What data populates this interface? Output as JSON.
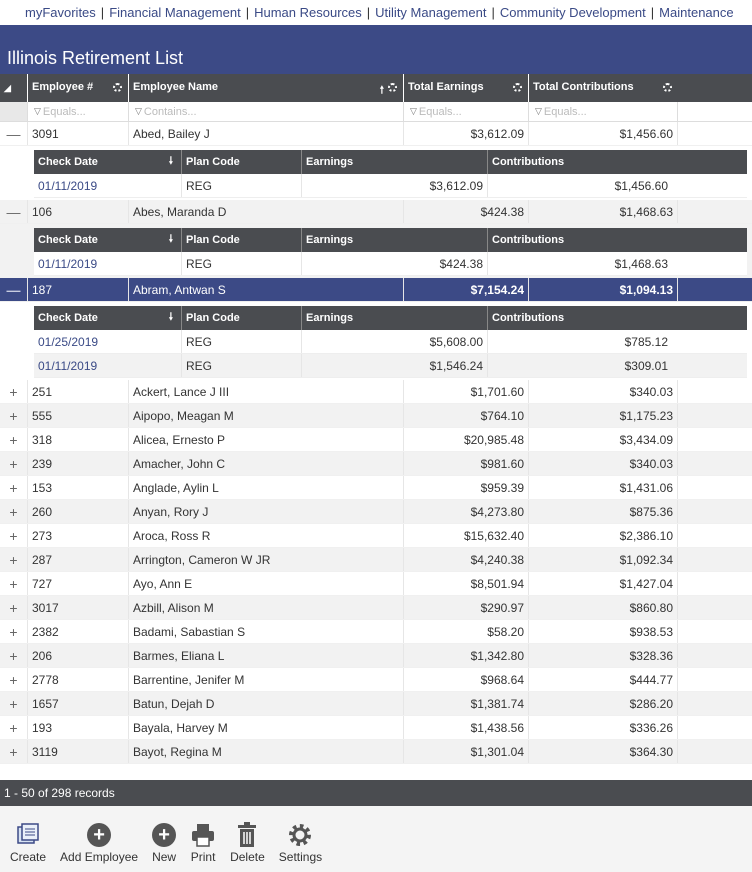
{
  "nav": [
    "myFavorites",
    "Financial Management",
    "Human Resources",
    "Utility Management",
    "Community Development",
    "Maintenance"
  ],
  "title": "Illinois Retirement List",
  "columns": {
    "employee_num": "Employee #",
    "employee_name": "Employee Name",
    "total_earnings": "Total Earnings",
    "total_contributions": "Total Contributions"
  },
  "filters": {
    "employee_num": "Equals...",
    "employee_name": "Contains...",
    "total_earnings": "Equals...",
    "total_contributions": "Equals..."
  },
  "sub_columns": {
    "check_date": "Check Date",
    "plan_code": "Plan Code",
    "earnings": "Earnings",
    "contributions": "Contributions"
  },
  "expanded": [
    {
      "num": "3091",
      "name": "Abed, Bailey J",
      "earn": "$3,612.09",
      "contrib": "$1,456.60",
      "details": [
        {
          "date": "01/11/2019",
          "plan": "REG",
          "earn": "$3,612.09",
          "contrib": "$1,456.60"
        }
      ]
    },
    {
      "num": "106",
      "name": "Abes, Maranda D",
      "earn": "$424.38",
      "contrib": "$1,468.63",
      "details": [
        {
          "date": "01/11/2019",
          "plan": "REG",
          "earn": "$424.38",
          "contrib": "$1,468.63"
        }
      ]
    },
    {
      "num": "187",
      "name": "Abram, Antwan S",
      "earn": "$7,154.24",
      "contrib": "$1,094.13",
      "details": [
        {
          "date": "01/25/2019",
          "plan": "REG",
          "earn": "$5,608.00",
          "contrib": "$785.12"
        },
        {
          "date": "01/11/2019",
          "plan": "REG",
          "earn": "$1,546.24",
          "contrib": "$309.01"
        }
      ]
    }
  ],
  "rows": [
    {
      "num": "251",
      "name": "Ackert, Lance J III",
      "earn": "$1,701.60",
      "contrib": "$340.03"
    },
    {
      "num": "555",
      "name": "Aipopo, Meagan M",
      "earn": "$764.10",
      "contrib": "$1,175.23"
    },
    {
      "num": "318",
      "name": "Alicea, Ernesto P",
      "earn": "$20,985.48",
      "contrib": "$3,434.09"
    },
    {
      "num": "239",
      "name": "Amacher, John C",
      "earn": "$981.60",
      "contrib": "$340.03"
    },
    {
      "num": "153",
      "name": "Anglade, Aylin L",
      "earn": "$959.39",
      "contrib": "$1,431.06"
    },
    {
      "num": "260",
      "name": "Anyan, Rory J",
      "earn": "$4,273.80",
      "contrib": "$875.36"
    },
    {
      "num": "273",
      "name": "Aroca, Ross R",
      "earn": "$15,632.40",
      "contrib": "$2,386.10"
    },
    {
      "num": "287",
      "name": "Arrington, Cameron W JR",
      "earn": "$4,240.38",
      "contrib": "$1,092.34"
    },
    {
      "num": "727",
      "name": "Ayo, Ann E",
      "earn": "$8,501.94",
      "contrib": "$1,427.04"
    },
    {
      "num": "3017",
      "name": "Azbill, Alison M",
      "earn": "$290.97",
      "contrib": "$860.80"
    },
    {
      "num": "2382",
      "name": "Badami, Sabastian S",
      "earn": "$58.20",
      "contrib": "$938.53"
    },
    {
      "num": "206",
      "name": "Barmes, Eliana L",
      "earn": "$1,342.80",
      "contrib": "$328.36"
    },
    {
      "num": "2778",
      "name": "Barrentine, Jenifer M",
      "earn": "$968.64",
      "contrib": "$444.77"
    },
    {
      "num": "1657",
      "name": "Batun, Dejah D",
      "earn": "$1,381.74",
      "contrib": "$286.20"
    },
    {
      "num": "193",
      "name": "Bayala, Harvey M",
      "earn": "$1,438.56",
      "contrib": "$336.26"
    },
    {
      "num": "3119",
      "name": "Bayot, Regina M",
      "earn": "$1,301.04",
      "contrib": "$364.30"
    }
  ],
  "status": "1 - 50 of 298 records",
  "toolbar": [
    "Create",
    "Add Employee",
    "New",
    "Print",
    "Delete",
    "Settings"
  ]
}
